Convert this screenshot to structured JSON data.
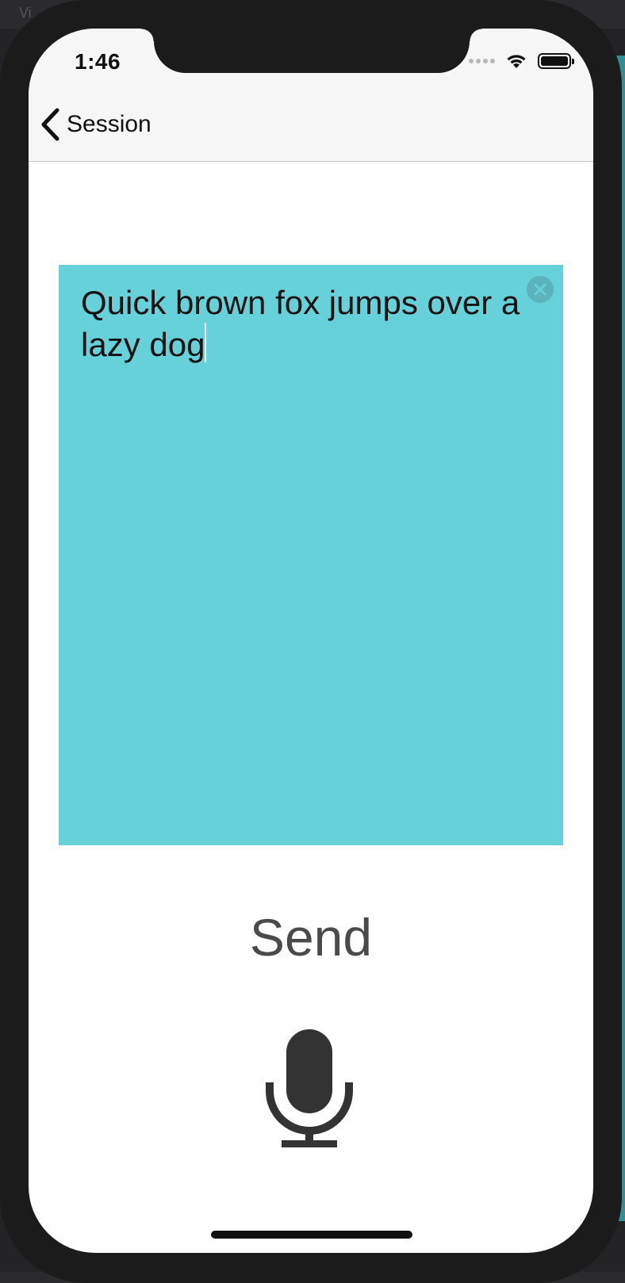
{
  "backdrop": {
    "label": "Vi"
  },
  "status_bar": {
    "time": "1:46"
  },
  "nav": {
    "back_label": "Session"
  },
  "note": {
    "text": "Quick brown fox jumps over a lazy dog",
    "background": "#67d1da"
  },
  "actions": {
    "send_label": "Send"
  },
  "icons": {
    "back": "chevron-left-icon",
    "clear": "clear-circle-icon",
    "mic": "microphone-icon",
    "wifi": "wifi-icon",
    "battery": "battery-icon"
  }
}
